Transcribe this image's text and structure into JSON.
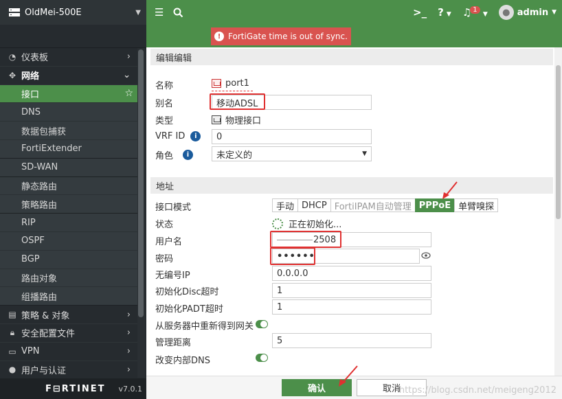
{
  "device": {
    "name": "OldMei-500E"
  },
  "sidebar": {
    "groups": [
      {
        "label": "仪表板",
        "icon": "dashboard-icon"
      },
      {
        "label": "网络",
        "icon": "network-icon"
      }
    ],
    "network_items": [
      {
        "label": "接口"
      },
      {
        "label": "DNS"
      },
      {
        "label": "数据包捕获"
      },
      {
        "label": "FortiExtender"
      },
      {
        "label": "SD-WAN"
      },
      {
        "label": "静态路由"
      },
      {
        "label": "策略路由"
      },
      {
        "label": "RIP"
      },
      {
        "label": "OSPF"
      },
      {
        "label": "BGP"
      },
      {
        "label": "路由对象"
      },
      {
        "label": "组播路由"
      }
    ],
    "bottom_groups": [
      {
        "label": "策略 & 对象"
      },
      {
        "label": "安全配置文件"
      },
      {
        "label": "VPN"
      },
      {
        "label": "用户与认证"
      }
    ],
    "brand": "F⊟RTINET",
    "version": "v7.0.1"
  },
  "topbar": {
    "notification_count": "1",
    "user": "admin"
  },
  "alert": {
    "text": "FortiGate time is out of sync."
  },
  "form": {
    "section_edit": "编辑编辑",
    "name_label": "名称",
    "name_value": "port1",
    "alias_label": "别名",
    "alias_value": "移动ADSL",
    "type_label": "类型",
    "type_value": "物理接口",
    "vrf_label": "VRF ID",
    "vrf_value": "0",
    "role_label": "角色",
    "role_value": "未定义的",
    "section_address": "地址",
    "mode_label": "接口模式",
    "modes": [
      "手动",
      "DHCP",
      "FortiIPAM自动管理",
      "PPPoE",
      "单臂嗅探"
    ],
    "status_label": "状态",
    "status_value": "正在初始化...",
    "username_label": "用户名",
    "username_value": "2508",
    "password_label": "密码",
    "password_value": "••••••",
    "unnumbered_label": "无编号IP",
    "unnumbered_value": "0.0.0.0",
    "disc_label": "初始化Disc超时",
    "disc_value": "1",
    "padt_label": "初始化PADT超时",
    "padt_value": "1",
    "gateway_label": "从服务器中重新得到网关",
    "distance_label": "管理距离",
    "distance_value": "5",
    "dns_label": "改变内部DNS"
  },
  "footer": {
    "ok_label": "确认",
    "cancel_label": "取消",
    "watermark": "https://blog.csdn.net/meigeng2012"
  },
  "colors": {
    "accent": "#4c8f4a",
    "alert": "#d9534f",
    "highlight": "#e03030",
    "sidebar": "#262b2f"
  }
}
